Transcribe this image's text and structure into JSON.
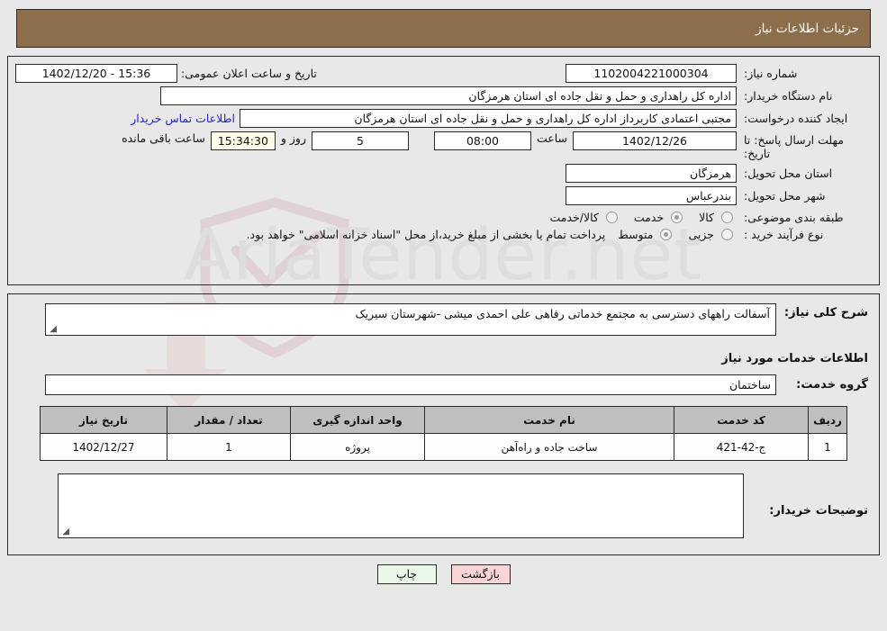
{
  "header": {
    "title": "جزئیات اطلاعات نیاز",
    "bg_color": "#8c6e4a"
  },
  "fields": {
    "need_number_label": "شماره نیاز:",
    "need_number_value": "1102004221000304",
    "public_announce_label": "تاریخ و ساعت اعلان عمومی:",
    "public_announce_value": "15:36 - 1402/12/20",
    "buyer_org_label": "نام دستگاه خریدار:",
    "buyer_org_value": "اداره کل راهداری و حمل و نقل جاده ای استان هرمزگان",
    "creator_label": "ایجاد کننده درخواست:",
    "creator_value": "مجتبی اعتمادی کاربرداز اداره کل راهداری و حمل و نقل جاده ای استان هرمزگان",
    "contact_link": "اطلاعات تماس خریدار",
    "deadline_label": "مهلت ارسال پاسخ: تا تاریخ:",
    "deadline_date": "1402/12/26",
    "deadline_hour_label": "ساعت",
    "deadline_hour": "08:00",
    "remaining_days": "5",
    "remaining_days_suffix": "روز و",
    "remaining_time": "15:34:30",
    "remaining_time_suffix": "ساعت باقی مانده",
    "province_label": "استان محل تحویل:",
    "province_value": "هرمزگان",
    "city_label": "شهر محل تحویل:",
    "city_value": "بندرعباس",
    "category_label": "طبقه بندی موضوعی:",
    "category_options": [
      {
        "label": "کالا",
        "selected": false
      },
      {
        "label": "خدمت",
        "selected": true
      },
      {
        "label": "کالا/خدمت",
        "selected": false
      }
    ],
    "process_label": "نوع فرآیند خرید :",
    "process_options": [
      {
        "label": "جزیی",
        "selected": false
      },
      {
        "label": "متوسط",
        "selected": true
      }
    ],
    "process_note": "پرداخت تمام یا بخشی از مبلغ خرید،از محل \"اسناد خزانه اسلامی\" خواهد بود."
  },
  "description": {
    "label": "شرح کلی نیاز:",
    "value": "آسفالت راههای دسترسی به مجتمع خدماتی رفاهی علی احمدی میشی -شهرستان سیریک"
  },
  "services": {
    "section_title": "اطلاعات خدمات مورد نیاز",
    "group_label": "گروه خدمت:",
    "group_value": "ساختمان",
    "columns": [
      "ردیف",
      "کد خدمت",
      "نام خدمت",
      "واحد اندازه گیری",
      "تعداد / مقدار",
      "تاریخ نیاز"
    ],
    "rows": [
      {
        "index": "1",
        "code": "ج-42-421",
        "name": "ساخت جاده و راه‌آهن",
        "unit": "پروژه",
        "quantity": "1",
        "need_date": "1402/12/27"
      }
    ]
  },
  "buyer_notes": {
    "label": "توضیحات خریدار:",
    "value": ""
  },
  "buttons": {
    "print": "چاپ",
    "back": "بازگشت"
  },
  "watermark": {
    "text": "AriaTender.net"
  }
}
